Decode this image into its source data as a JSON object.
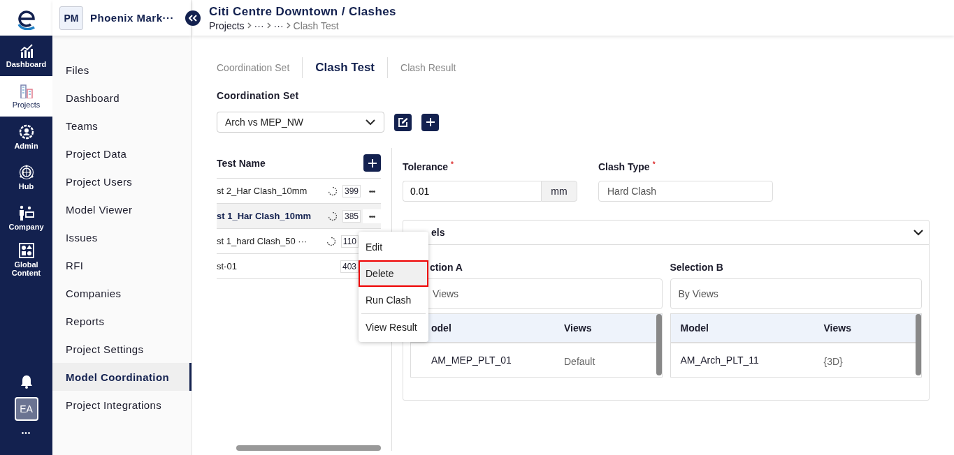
{
  "rail": {
    "items": [
      {
        "label": "Dashboard",
        "selected": false
      },
      {
        "label": "Projects",
        "selected": true
      },
      {
        "label": "Admin",
        "selected": false
      },
      {
        "label": "Hub",
        "selected": false
      },
      {
        "label": "Company",
        "selected": false
      },
      {
        "label": "Global Content",
        "selected": false
      }
    ],
    "avatar": "EA",
    "more": "•••"
  },
  "project": {
    "badge": "PM",
    "name": "Phoenix Mark···"
  },
  "header": {
    "title": "Citi Centre Downtown / Clashes",
    "breadcrumb": [
      "Projects",
      "···",
      "···",
      "Clash Test"
    ]
  },
  "sidebar": {
    "items": [
      {
        "label": "Files",
        "selected": false
      },
      {
        "label": "Dashboard",
        "selected": false
      },
      {
        "label": "Teams",
        "selected": false
      },
      {
        "label": "Project Data",
        "selected": false
      },
      {
        "label": "Project Users",
        "selected": false
      },
      {
        "label": "Model Viewer",
        "selected": false
      },
      {
        "label": "Issues",
        "selected": false
      },
      {
        "label": "RFI",
        "selected": false
      },
      {
        "label": "Companies",
        "selected": false
      },
      {
        "label": "Reports",
        "selected": false
      },
      {
        "label": "Project Settings",
        "selected": false
      },
      {
        "label": "Model Coordination",
        "selected": true
      },
      {
        "label": "Project Integrations",
        "selected": false
      }
    ]
  },
  "tabs": [
    {
      "label": "Coordination Set",
      "selected": false
    },
    {
      "label": "Clash Test",
      "selected": true
    },
    {
      "label": "Clash Result",
      "selected": false
    }
  ],
  "coordination_set": {
    "label": "Coordination Set",
    "value": "Arch vs MEP_NW"
  },
  "tests": {
    "heading": "Test Name",
    "rows": [
      {
        "name": "st 2_Har Clash_10mm",
        "count": "399",
        "syncing": true,
        "more": "•••",
        "selected": false
      },
      {
        "name": "st 1_Har Clash_10mm",
        "count": "385",
        "syncing": true,
        "more": "•••",
        "selected": true
      },
      {
        "name": "st 1_hard Clash_50 ···",
        "count": "110",
        "syncing": true,
        "selected": false
      },
      {
        "name": "st-01",
        "count": "403",
        "syncing": false,
        "selected": false
      }
    ]
  },
  "menu": [
    {
      "label": "Edit",
      "selected": false,
      "separated": false
    },
    {
      "label": "Delete",
      "selected": true,
      "separated": false
    },
    {
      "label": "Run Clash",
      "selected": false,
      "separated": false
    },
    {
      "label": "View Result",
      "selected": false,
      "separated": true
    }
  ],
  "tolerance": {
    "label": "Tolerance",
    "required_mark": "*",
    "value": "0.01",
    "unit": "mm"
  },
  "clash_type": {
    "label": "Clash Type",
    "required_mark": "*",
    "value": "Hard Clash"
  },
  "models": {
    "title": "els",
    "expanded": true,
    "selections": [
      {
        "label": "ction A",
        "field": "Views",
        "columns": [
          "odel",
          "Views"
        ],
        "rows": [
          [
            "AM_MEP_PLT_01",
            "Default"
          ]
        ]
      },
      {
        "label": "Selection B",
        "field": "By Views",
        "columns": [
          "Model",
          "Views"
        ],
        "rows": [
          [
            "AM_Arch_PLT_11",
            "{3D}"
          ]
        ]
      }
    ]
  }
}
